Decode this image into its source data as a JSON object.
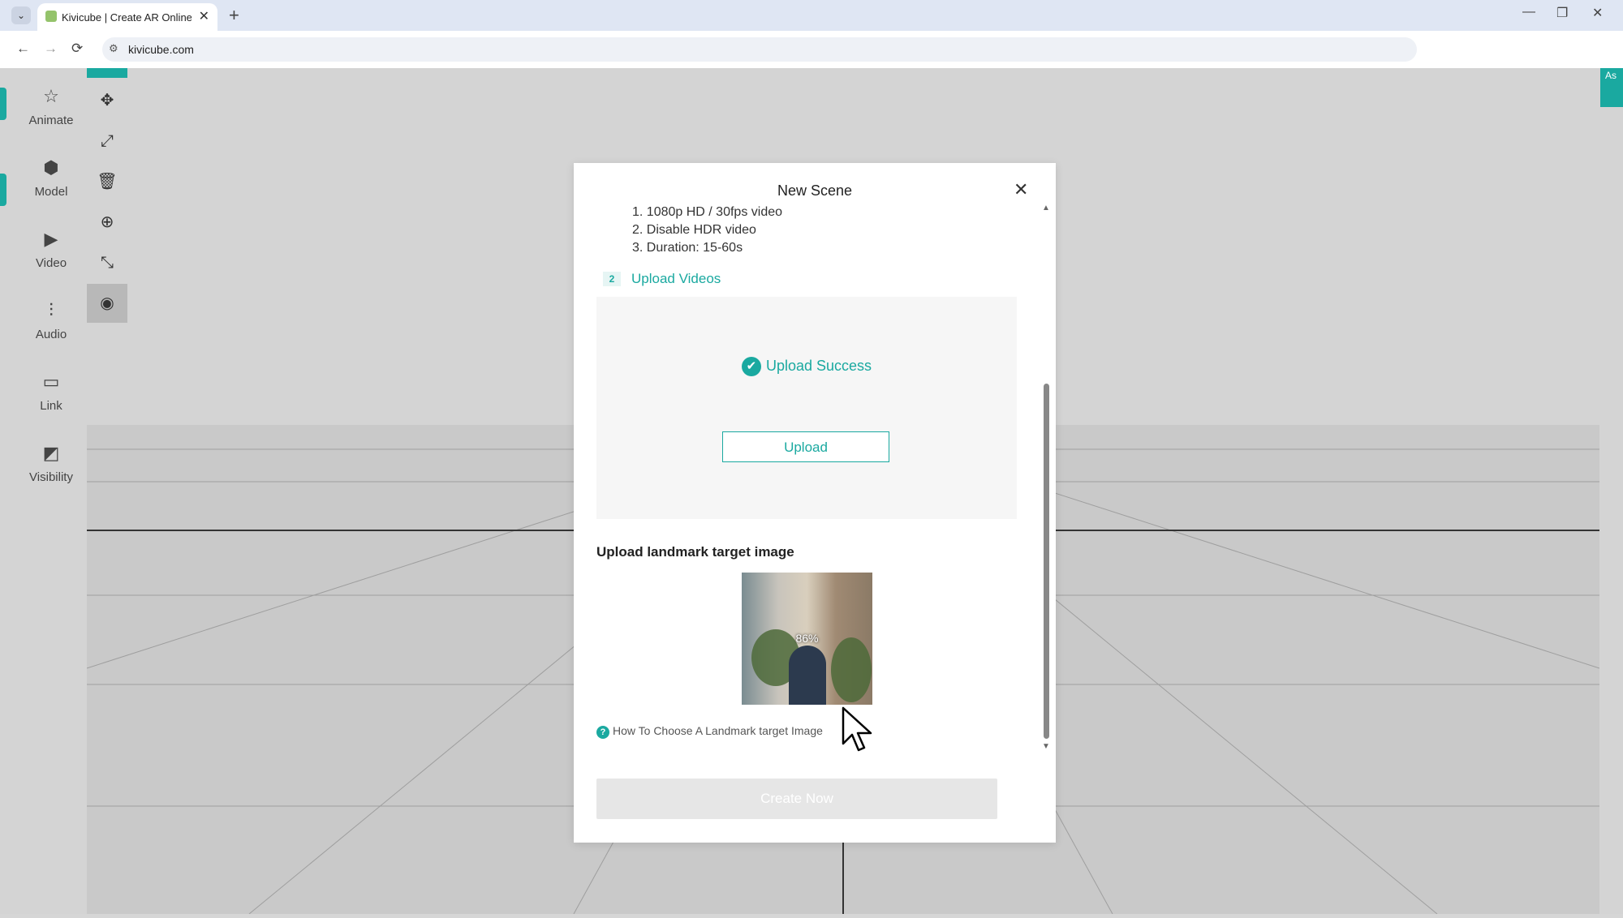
{
  "browser": {
    "tab_title": "Kivicube | Create AR Online -",
    "tab_close": "✕",
    "new_tab": "+",
    "url": "kivicube.com",
    "nav_back": "←",
    "nav_forward": "→",
    "nav_reload": "⟳",
    "tab_list": "⌄",
    "win_min": "—",
    "win_restore": "❐",
    "win_close": "✕",
    "site_info": "⚙"
  },
  "sidebar": {
    "items": [
      {
        "label": "Animate",
        "icon": "☆"
      },
      {
        "label": "Model",
        "icon": "⬢"
      },
      {
        "label": "Video",
        "icon": "▶"
      },
      {
        "label": "Audio",
        "icon": "⫶"
      },
      {
        "label": "Link",
        "icon": "▭"
      },
      {
        "label": "Visibility",
        "icon": "◩"
      }
    ]
  },
  "tools": [
    {
      "icon": "✥"
    },
    {
      "icon": "⤢"
    },
    {
      "icon": "🗑"
    },
    {
      "icon": "⊕"
    },
    {
      "icon": "⤡"
    },
    {
      "icon": "◉"
    }
  ],
  "right_badge": "As",
  "modal": {
    "title": "New Scene",
    "close": "✕",
    "requirements": [
      "1. 1080p HD / 30fps video",
      "2. Disable HDR video",
      "3. Duration: 15-60s"
    ],
    "step_badge": "2",
    "step_label": "Upload Videos",
    "upload_success": "Upload Success",
    "upload_check": "✔",
    "upload_button": "Upload",
    "landmark_label": "Upload landmark target image",
    "thumb_progress": "86%",
    "help_icon": "?",
    "help_text": "How To Choose A Landmark target Image",
    "create_button": "Create Now",
    "scroll_up": "▲",
    "scroll_down": "▼"
  },
  "colors": {
    "accent": "#1aa9a0"
  }
}
